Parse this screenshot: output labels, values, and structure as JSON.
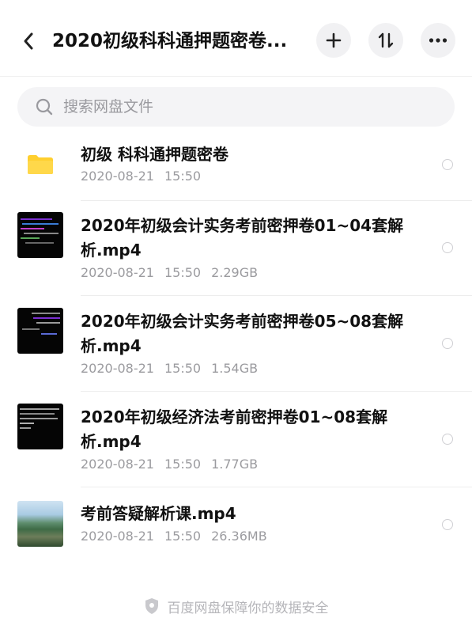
{
  "header": {
    "title": "2020初级科科通押题密卷...",
    "back_icon": "back-chevron-icon",
    "add_icon": "plus-icon",
    "sort_icon": "sort-icon",
    "more_icon": "more-dots-icon"
  },
  "search": {
    "placeholder": "搜索网盘文件",
    "value": "",
    "icon": "search-icon"
  },
  "files": [
    {
      "type": "folder",
      "name": "初级 科科通押题密卷",
      "date": "2020-08-21",
      "time": "15:50",
      "size": "",
      "icon": "folder-icon"
    },
    {
      "type": "video",
      "name": "2020年初级会计实务考前密押卷01~04套解析.mp4",
      "date": "2020-08-21",
      "time": "15:50",
      "size": "2.29GB",
      "icon": "video-thumbnail"
    },
    {
      "type": "video",
      "name": "2020年初级会计实务考前密押卷05~08套解析.mp4",
      "date": "2020-08-21",
      "time": "15:50",
      "size": "1.54GB",
      "icon": "video-thumbnail"
    },
    {
      "type": "video",
      "name": "2020年初级经济法考前密押卷01~08套解析.mp4",
      "date": "2020-08-21",
      "time": "15:50",
      "size": "1.77GB",
      "icon": "video-thumbnail"
    },
    {
      "type": "video",
      "name": "考前答疑解析课.mp4",
      "date": "2020-08-21",
      "time": "15:50",
      "size": "26.36MB",
      "icon": "landscape-thumbnail"
    }
  ],
  "footer": {
    "text": "百度网盘保障你的数据安全",
    "icon": "shield-icon"
  },
  "colors": {
    "folder": "#FFCF2E",
    "meta_text": "#9B9B9F",
    "button_bg": "#F1F1F3",
    "search_bg": "#F4F4F6"
  }
}
